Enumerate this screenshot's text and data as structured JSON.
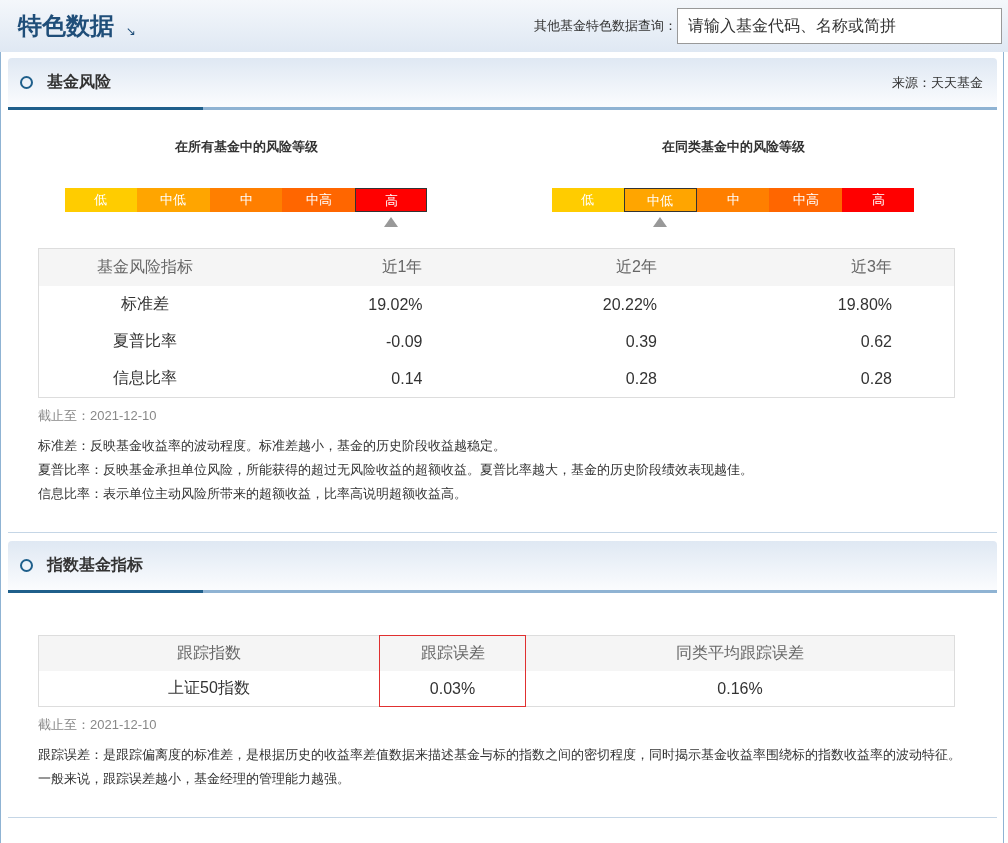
{
  "header": {
    "title": "特色数据",
    "arrow": "↘",
    "search_label": "其他基金特色数据查询：",
    "search": {
      "placeholder": "请输入基金代码、名称或简拼"
    }
  },
  "risk_section": {
    "title": "基金风险",
    "source": "来源：天天基金",
    "scales": [
      {
        "title": "在所有基金中的风险等级",
        "levels": [
          {
            "label": "低",
            "color": "#ffcc00",
            "selected": false
          },
          {
            "label": "中低",
            "color": "#ffa500",
            "selected": false
          },
          {
            "label": "中",
            "color": "#ff7f00",
            "selected": false
          },
          {
            "label": "中高",
            "color": "#ff6600",
            "selected": false
          },
          {
            "label": "高",
            "color": "#ff0000",
            "selected": true
          }
        ]
      },
      {
        "title": "在同类基金中的风险等级",
        "levels": [
          {
            "label": "低",
            "color": "#ffcc00",
            "selected": false
          },
          {
            "label": "中低",
            "color": "#ffa500",
            "selected": true
          },
          {
            "label": "中",
            "color": "#ff7f00",
            "selected": false
          },
          {
            "label": "中高",
            "color": "#ff6600",
            "selected": false
          },
          {
            "label": "高",
            "color": "#ff0000",
            "selected": false
          }
        ]
      }
    ],
    "table": {
      "columns": [
        "基金风险指标",
        "近1年",
        "近2年",
        "近3年"
      ],
      "rows": [
        [
          "标准差",
          "19.02%",
          "20.22%",
          "19.80%"
        ],
        [
          "夏普比率",
          "-0.09",
          "0.39",
          "0.62"
        ],
        [
          "信息比率",
          "0.14",
          "0.28",
          "0.28"
        ]
      ]
    },
    "date": "截止至：2021-12-10",
    "notes": [
      "标准差：反映基金收益率的波动程度。标准差越小，基金的历史阶段收益越稳定。",
      "夏普比率：反映基金承担单位风险，所能获得的超过无风险收益的超额收益。夏普比率越大，基金的历史阶段绩效表现越佳。",
      "信息比率：表示单位主动风险所带来的超额收益，比率高说明超额收益高。"
    ]
  },
  "index_section": {
    "title": "指数基金指标",
    "table": {
      "columns": [
        {
          "label": "跟踪指数",
          "highlighted": false
        },
        {
          "label": "跟踪误差",
          "highlighted": true
        },
        {
          "label": "同类平均跟踪误差",
          "highlighted": false
        }
      ],
      "rows": [
        [
          "上证50指数",
          "0.03%",
          "0.16%"
        ]
      ]
    },
    "date": "截止至：2021-12-10",
    "notes": [
      "跟踪误差：是跟踪偏离度的标准差，是根据历史的收益率差值数据来描述基金与标的指数之间的密切程度，同时揭示基金收益率围绕标的指数收益率的波动特征。一般来说，跟踪误差越小，基金经理的管理能力越强。"
    ]
  }
}
